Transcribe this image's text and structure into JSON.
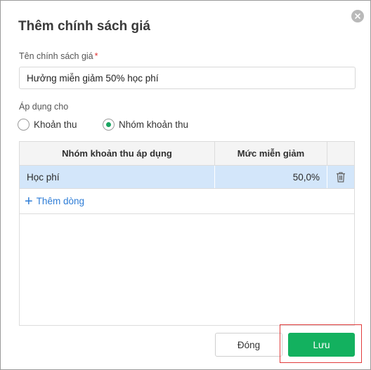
{
  "dialog": {
    "title": "Thêm chính sách giá",
    "close_icon": "close-icon"
  },
  "form": {
    "name_label": "Tên chính sách giá",
    "required_mark": "*",
    "name_value": "Hưởng miễn giảm 50% học phí",
    "apply_label": "Áp dụng cho",
    "options": [
      {
        "label": "Khoản thu",
        "selected": false
      },
      {
        "label": "Nhóm khoản thu",
        "selected": true
      }
    ]
  },
  "table": {
    "columns": [
      "Nhóm khoản thu áp dụng",
      "Mức miễn giảm"
    ],
    "rows": [
      {
        "group": "Học phí",
        "discount": "50,0%",
        "action_icon": "trash-icon"
      }
    ],
    "add_row_label": "Thêm dòng"
  },
  "footer": {
    "close_label": "Đóng",
    "save_label": "Lưu"
  },
  "colors": {
    "accent": "#13b15f",
    "selected_row": "#d3e6fa",
    "link": "#2d7cd6",
    "highlight": "#e23b3b"
  }
}
